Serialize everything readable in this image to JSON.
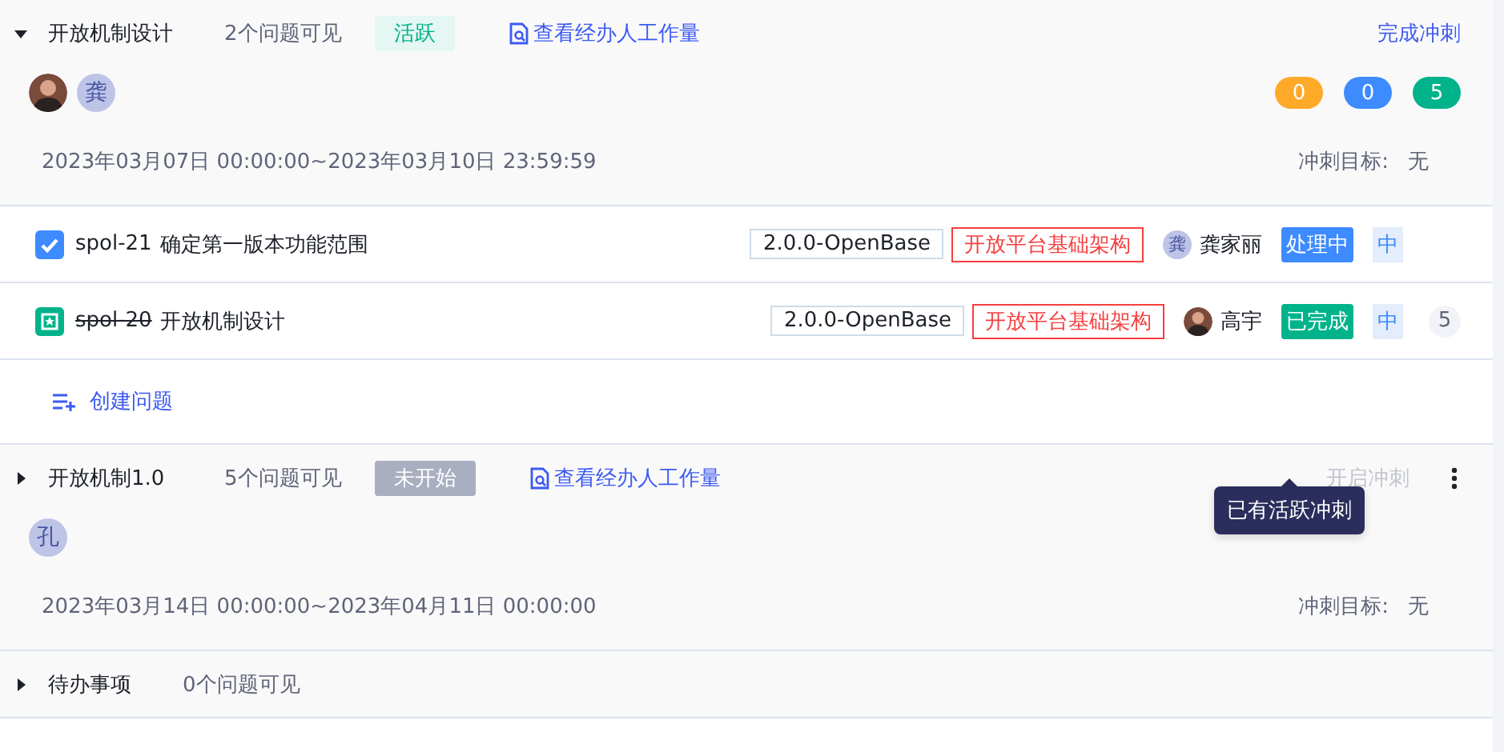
{
  "sprints": [
    {
      "name": "开放机制设计",
      "expanded": true,
      "issue_count": "2个问题可见",
      "status": {
        "label": "活跃",
        "kind": "active"
      },
      "workload_link": "查看经办人工作量",
      "action": {
        "label": "完成冲刺",
        "disabled": false
      },
      "avatars": [
        {
          "kind": "photo"
        },
        {
          "kind": "initial",
          "text": "龚"
        }
      ],
      "counts": [
        {
          "value": "0",
          "color": "#ffa929"
        },
        {
          "value": "0",
          "color": "#3d8bff"
        },
        {
          "value": "5",
          "color": "#00b38a"
        }
      ],
      "date_range": "2023年03月07日 00:00:00~2023年03月10日 23:59:59",
      "goal_label": "冲刺目标:",
      "goal_value": "无",
      "issues": [
        {
          "kind": "task",
          "key": "spol-21",
          "done": false,
          "title": "确定第一版本功能范围",
          "version": "2.0.0-OpenBase",
          "epic": "开放平台基础架构",
          "assignee": {
            "kind": "initial",
            "initial": "龚",
            "name": "龚家丽"
          },
          "status": {
            "label": "处理中",
            "color": "#3d8bff"
          },
          "priority": "中"
        },
        {
          "kind": "story",
          "key": "spol-20",
          "done": true,
          "title": "开放机制设计",
          "version": "2.0.0-OpenBase",
          "epic": "开放平台基础架构",
          "assignee": {
            "kind": "photo",
            "name": "高宇"
          },
          "status": {
            "label": "已完成",
            "color": "#00b38a"
          },
          "priority": "中",
          "points": "5"
        }
      ],
      "create_label": "创建问题"
    },
    {
      "name": "开放机制1.0",
      "expanded": false,
      "issue_count": "5个问题可见",
      "status": {
        "label": "未开始",
        "kind": "planned"
      },
      "workload_link": "查看经办人工作量",
      "action": {
        "label": "开启冲刺",
        "disabled": true
      },
      "menu": true,
      "tooltip": "已有活跃冲刺",
      "avatars": [
        {
          "kind": "initial",
          "text": "孔"
        }
      ],
      "date_range": "2023年03月14日 00:00:00~2023年04月11日 00:00:00",
      "goal_label": "冲刺目标:",
      "goal_value": "无"
    }
  ],
  "backlog": {
    "name": "待办事项",
    "expanded": false,
    "issue_count": "0个问题可见"
  }
}
